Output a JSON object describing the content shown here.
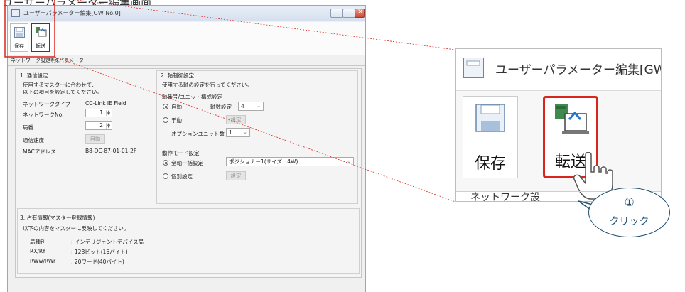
{
  "page_heading": "ユーザーパラメーター編集画面",
  "window": {
    "title": "ユーザーパラメーター編集[GW No.0]",
    "ribbon": {
      "save_label": "保存",
      "transfer_label": "転送"
    },
    "tabs": [
      "ネットワーク設定",
      "特殊パラメーター"
    ]
  },
  "comm": {
    "title": "1. 通信設定",
    "desc1": "使用するマスターに合わせて、",
    "desc2": "以下の項目を設定してください。",
    "network_type_label": "ネットワークタイプ",
    "network_type_value": "CC-Link IE Field",
    "network_no_label": "ネットワークNo.",
    "network_no_value": "1",
    "station_label": "局番",
    "station_value": "2",
    "speed_label": "通信速度",
    "speed_value": "自動",
    "mac_label": "MACアドレス",
    "mac_value": "B8-DC-87-01-01-2F"
  },
  "axis": {
    "title": "2. 軸制御設定",
    "desc": "使用する軸の設定を行ってください。",
    "group_title": "軸番号/ユニット構成設定",
    "auto_label": "自動",
    "axis_count_label": "軸数設定",
    "axis_count_value": "4",
    "manual_label": "手動",
    "manual_btn": "設定",
    "option_label": "オプションユニット数",
    "option_value": "1",
    "mode_group_title": "動作モード設定",
    "all_axis_label": "全軸一括設定",
    "all_axis_value": "ポジショナー1(サイズ : 4W)",
    "individual_label": "個別設定",
    "individual_btn": "設定"
  },
  "occupied": {
    "title": "3. 占有情報(マスター登録情報)",
    "desc": "以下の内容をマスターに反映してください。",
    "rows": [
      {
        "label": "局種別",
        "value": ": インテリジェントデバイス局"
      },
      {
        "label": "RX/RY",
        "value": ": 128ビット(16バイト)"
      },
      {
        "label": "RWw/RWr",
        "value": ": 20ワード(40バイト)"
      }
    ]
  },
  "zoom": {
    "title": "ユーザーパラメーター編集[GW",
    "save_label": "保存",
    "transfer_label": "転送",
    "bottom_text": "ネットワーク設"
  },
  "callout": {
    "number": "①",
    "text": "クリック"
  },
  "colors": {
    "highlight": "#d9261c",
    "callout": "#1f4e6e"
  },
  "icons": [
    "save-icon",
    "transfer-icon",
    "hand-cursor-icon"
  ]
}
